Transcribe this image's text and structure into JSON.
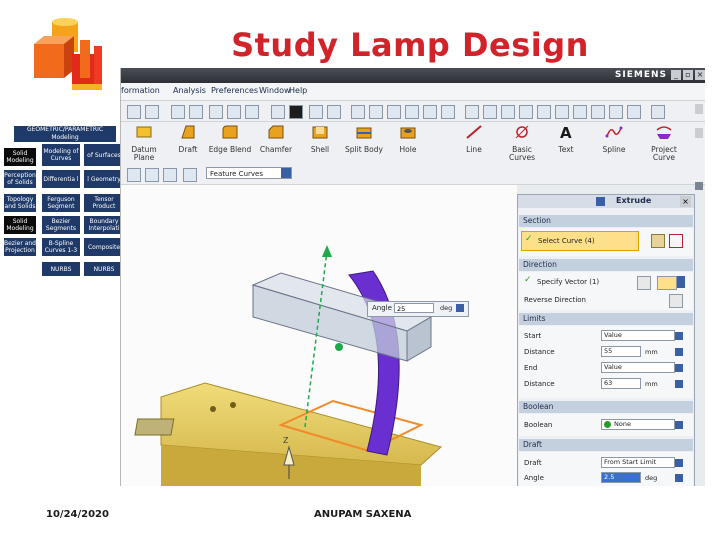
{
  "slide": {
    "title": "Study Lamp Design",
    "date": "10/24/2020",
    "author": "ANUPAM SAXENA"
  },
  "left_panel": {
    "header": "GEOMETRIC/PARAMETRIC Modeling",
    "cells": [
      {
        "label": "Solid Modeling"
      },
      {
        "label": "Modeling of Curves"
      },
      {
        "label": "of Surfaces"
      },
      {
        "label": "Perception of Solids"
      },
      {
        "label": "Differentia l"
      },
      {
        "label": "l Geometry"
      },
      {
        "label": "Topology and Solids"
      },
      {
        "label": "Ferguson Segment"
      },
      {
        "label": "Tensor Product"
      },
      {
        "label": "Solid Modeling"
      },
      {
        "label": "Bezier Segments"
      },
      {
        "label": "Boundary Interpolati"
      },
      {
        "label": "Bezier and Projection"
      },
      {
        "label": "B-Spline Curves 1-3"
      },
      {
        "label": "Composite"
      },
      {
        "label": "NURBS"
      },
      {
        "label": "NURBS"
      }
    ]
  },
  "app": {
    "brand": "SIEMENS",
    "menu": [
      "formation",
      "Analysis",
      "Preferences",
      "Window",
      "Help"
    ],
    "tools": [
      {
        "label": "Datum Plane",
        "icon": "datum-plane-icon"
      },
      {
        "label": "Draft",
        "icon": "draft-icon"
      },
      {
        "label": "Edge Blend",
        "icon": "edge-blend-icon"
      },
      {
        "label": "Chamfer",
        "icon": "chamfer-icon"
      },
      {
        "label": "Shell",
        "icon": "shell-icon"
      },
      {
        "label": "Split Body",
        "icon": "split-body-icon"
      },
      {
        "label": "Hole",
        "icon": "hole-icon"
      },
      {
        "label": "Line",
        "icon": "line-icon"
      },
      {
        "label": "Basic Curves",
        "icon": "basic-curves-icon"
      },
      {
        "label": "Text",
        "icon": "text-icon"
      },
      {
        "label": "Spline",
        "icon": "spline-icon"
      },
      {
        "label": "Project Curve",
        "icon": "project-curve-icon"
      }
    ],
    "filter_value": "Feature Curves",
    "viewport": {
      "angle_label": "Angle",
      "angle_value": "25",
      "angle_unit": "deg",
      "axis_z": "Z"
    }
  },
  "dialog": {
    "title": "Extrude",
    "section": {
      "head": "Section",
      "select_curve": "Select Curve (4)"
    },
    "direction": {
      "head": "Direction",
      "specify_vector": "Specify Vector (1)",
      "reverse": "Reverse Direction"
    },
    "limits": {
      "head": "Limits",
      "start_label": "Start",
      "start_value": "Value",
      "distance_label": "Distance",
      "start_distance": "55",
      "distance_unit": "mm",
      "end_label": "End",
      "end_value": "Value",
      "end_distance_label": "Distance",
      "end_distance": "63"
    },
    "boolean": {
      "head": "Boolean",
      "label": "Boolean",
      "value": "None"
    },
    "draft": {
      "head": "Draft",
      "draft_label": "Draft",
      "draft_value": "From Start Limit",
      "angle_label": "Angle",
      "angle_value": "2.5",
      "angle_unit": "deg"
    }
  }
}
